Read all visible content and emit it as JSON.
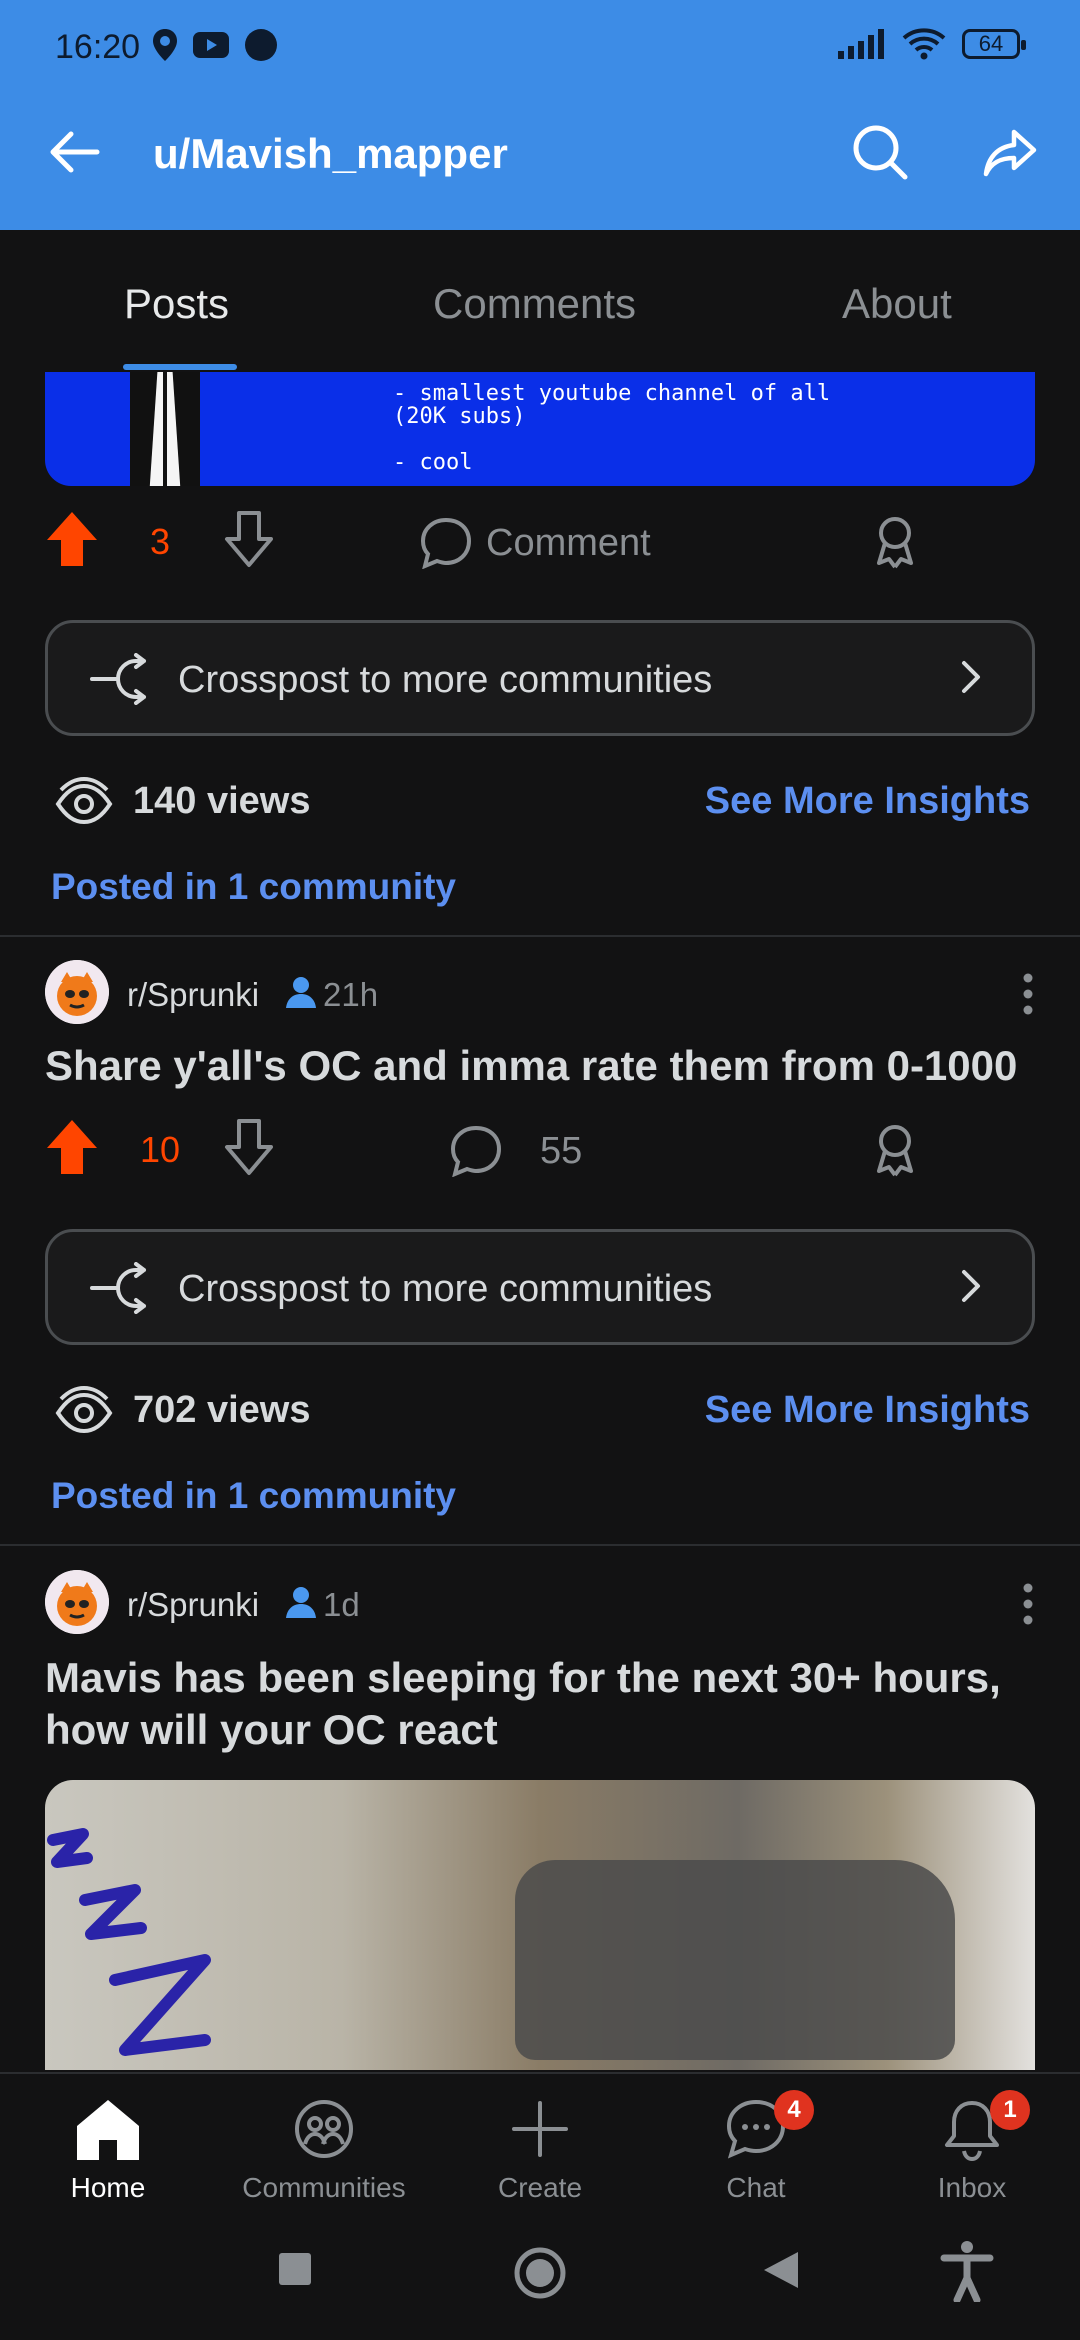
{
  "status_bar": {
    "time": "16:20",
    "battery": "64"
  },
  "header": {
    "title": "u/Mavish_mapper"
  },
  "tabs": [
    "Posts",
    "Comments",
    "About"
  ],
  "banner": {
    "lines": [
      "- smallest youtube channel of all",
      "(20K subs)",
      "",
      "- cool"
    ]
  },
  "post1": {
    "votes": "3",
    "comment_label": "Comment",
    "crosspost_label": "Crosspost to more communities",
    "views": "140 views",
    "insights": "See More Insights",
    "posted_in": "Posted in 1 community"
  },
  "post2": {
    "subreddit": "r/Sprunki",
    "age": "21h",
    "title": "Share y'all's OC and imma rate them from 0-1000",
    "votes": "10",
    "comments": "55",
    "crosspost_label": "Crosspost to more communities",
    "views": "702 views",
    "insights": "See More Insights",
    "posted_in": "Posted in 1 community"
  },
  "post3": {
    "subreddit": "r/Sprunki",
    "age": "1d",
    "title_line1": "Mavis has been sleeping for the next 30+ hours,",
    "title_line2": "how will your OC react"
  },
  "bottom_nav": {
    "home": "Home",
    "communities": "Communities",
    "create": "Create",
    "chat": "Chat",
    "chat_badge": "4",
    "inbox": "Inbox",
    "inbox_badge": "1"
  },
  "colors": {
    "header_bg": "#3d8ce6",
    "upvote": "#ff4500",
    "link": "#5c8ff0",
    "background": "#121213"
  }
}
